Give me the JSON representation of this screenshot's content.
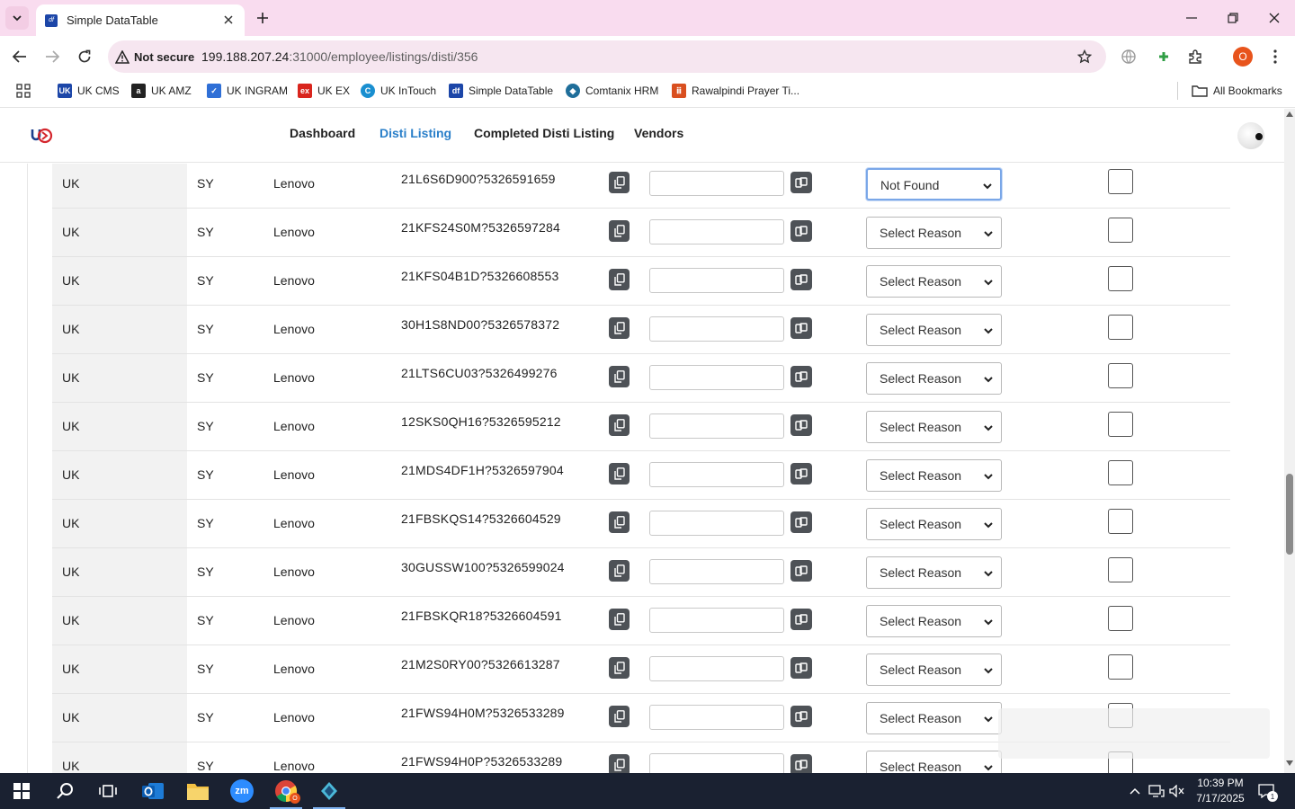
{
  "browser": {
    "tab_title": "Simple DataTable",
    "tab_favicon_text": "df",
    "address": {
      "security_label": "Not secure",
      "host": "199.188.207.24",
      "path": ":31000/employee/listings/disti/356"
    },
    "profile_initial": "O",
    "bookmarks": [
      {
        "label": "UK CMS",
        "icon": "uk-cms-icon",
        "color": "#1c46a8",
        "glyph": "UK"
      },
      {
        "label": "UK AMZ",
        "icon": "amazon-icon",
        "color": "#222222",
        "glyph": "a"
      },
      {
        "label": "UK INGRAM",
        "icon": "ingram-icon",
        "color": "#2f6fd6",
        "glyph": "✓"
      },
      {
        "label": "UK EX",
        "icon": "ex-icon",
        "color": "#d9251d",
        "glyph": "ex"
      },
      {
        "label": "UK InTouch",
        "icon": "intouch-icon",
        "color": "#1a8fd0",
        "glyph": "C"
      },
      {
        "label": "Simple DataTable",
        "icon": "datatable-icon",
        "color": "#1c46a8",
        "glyph": "df"
      },
      {
        "label": "Comtanix HRM",
        "icon": "hrm-icon",
        "color": "#1f6e9a",
        "glyph": "◆"
      },
      {
        "label": "Rawalpindi Prayer Ti...",
        "icon": "prayer-icon",
        "color": "#d94f1f",
        "glyph": "ⅲ"
      }
    ],
    "all_bookmarks_label": "All Bookmarks"
  },
  "app": {
    "nav": [
      {
        "label": "Dashboard",
        "active": false
      },
      {
        "label": "Disti Listing",
        "active": true
      },
      {
        "label": "Completed Disti Listing",
        "active": false
      },
      {
        "label": "Vendors",
        "active": false
      }
    ],
    "accent_color": "#2a7fc9"
  },
  "table": {
    "rows": [
      {
        "country": "UK",
        "code": "SY",
        "vendor": "Lenovo",
        "part": "21L6S6D900?5326591659",
        "reason": "Not Found"
      },
      {
        "country": "UK",
        "code": "SY",
        "vendor": "Lenovo",
        "part": "21KFS24S0M?5326597284",
        "reason": "Select Reason"
      },
      {
        "country": "UK",
        "code": "SY",
        "vendor": "Lenovo",
        "part": "21KFS04B1D?5326608553",
        "reason": "Select Reason"
      },
      {
        "country": "UK",
        "code": "SY",
        "vendor": "Lenovo",
        "part": "30H1S8ND00?5326578372",
        "reason": "Select Reason"
      },
      {
        "country": "UK",
        "code": "SY",
        "vendor": "Lenovo",
        "part": "21LTS6CU03?5326499276",
        "reason": "Select Reason"
      },
      {
        "country": "UK",
        "code": "SY",
        "vendor": "Lenovo",
        "part": "12SKS0QH16?5326595212",
        "reason": "Select Reason"
      },
      {
        "country": "UK",
        "code": "SY",
        "vendor": "Lenovo",
        "part": "21MDS4DF1H?5326597904",
        "reason": "Select Reason"
      },
      {
        "country": "UK",
        "code": "SY",
        "vendor": "Lenovo",
        "part": "21FBSKQS14?5326604529",
        "reason": "Select Reason"
      },
      {
        "country": "UK",
        "code": "SY",
        "vendor": "Lenovo",
        "part": "30GUSSW100?5326599024",
        "reason": "Select Reason"
      },
      {
        "country": "UK",
        "code": "SY",
        "vendor": "Lenovo",
        "part": "21FBSKQR18?5326604591",
        "reason": "Select Reason"
      },
      {
        "country": "UK",
        "code": "SY",
        "vendor": "Lenovo",
        "part": "21M2S0RY00?5326613287",
        "reason": "Select Reason"
      },
      {
        "country": "UK",
        "code": "SY",
        "vendor": "Lenovo",
        "part": "21FWS94H0M?5326533289",
        "reason": "Select Reason"
      },
      {
        "country": "UK",
        "code": "SY",
        "vendor": "Lenovo",
        "part": "21FWS94H0P?5326533289",
        "reason": "Select Reason"
      }
    ]
  },
  "taskbar": {
    "time": "10:39 PM",
    "date": "7/17/2025",
    "notification_count": "1"
  }
}
